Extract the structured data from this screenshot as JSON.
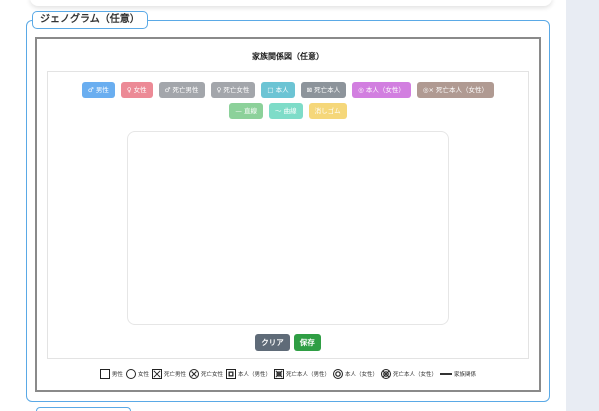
{
  "section": {
    "legend": "ジェノグラム（任意）",
    "title": "家族関係図（任意）"
  },
  "palette_row1": [
    {
      "key": "male",
      "label": "♂ 男性",
      "color": "#6aaef0"
    },
    {
      "key": "female",
      "label": "♀ 女性",
      "color": "#ec8a96"
    },
    {
      "key": "deceased_male",
      "label": "♂ 死亡男性",
      "color": "#a3a6ab"
    },
    {
      "key": "deceased_female",
      "label": "♀ 死亡女性",
      "color": "#a3a6ab"
    },
    {
      "key": "self",
      "label": "□ 本人",
      "color": "#6cc4d4"
    },
    {
      "key": "deceased_self",
      "label": "⊠ 死亡本人",
      "color": "#8d949b"
    },
    {
      "key": "self_female",
      "label": "◎ 本人（女性）",
      "color": "#d27fe0"
    },
    {
      "key": "deceased_self_female",
      "label": "◎× 死亡本人（女性）",
      "color": "#b09a92"
    }
  ],
  "palette_row2": [
    {
      "key": "straight_line",
      "label": "— 直線",
      "color": "#8cd19a"
    },
    {
      "key": "curve_line",
      "label": "〜 曲線",
      "color": "#7edcc8"
    },
    {
      "key": "eraser",
      "label": "消しゴム",
      "color": "#f5d77a"
    }
  ],
  "actions": {
    "clear": {
      "label": "クリア",
      "color": "#5f6b78"
    },
    "save": {
      "label": "保存",
      "color": "#2f9e44"
    }
  },
  "legend_items": [
    {
      "symbol": "square",
      "label": "男性"
    },
    {
      "symbol": "circle",
      "label": "女性"
    },
    {
      "symbol": "square-x",
      "label": "死亡男性"
    },
    {
      "symbol": "circle-x",
      "label": "死亡女性"
    },
    {
      "symbol": "double-square",
      "label": "本人（男性）"
    },
    {
      "symbol": "double-square-x",
      "label": "死亡本人（男性）"
    },
    {
      "symbol": "double-circle",
      "label": "本人（女性）"
    },
    {
      "symbol": "double-circle-x",
      "label": "死亡本人（女性）"
    },
    {
      "symbol": "line",
      "label": "家族関係"
    }
  ]
}
